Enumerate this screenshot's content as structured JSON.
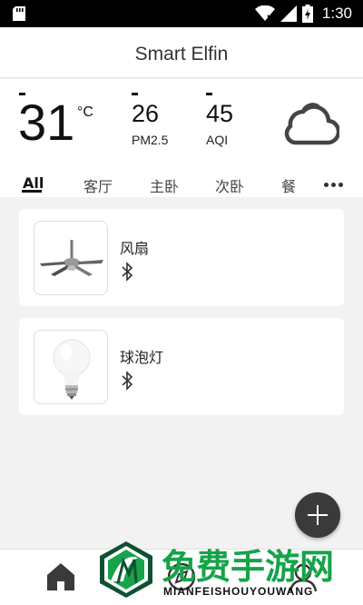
{
  "status_bar": {
    "time": "1:30",
    "icons": [
      "sd-card-icon",
      "wifi-icon",
      "signal-icon",
      "battery-charging-icon"
    ]
  },
  "header": {
    "title": "Smart Elfin"
  },
  "weather": {
    "temperature": "31",
    "unit": "°C",
    "pm25_value": "26",
    "pm25_label": "PM2.5",
    "aqi_value": "45",
    "aqi_label": "AQI",
    "condition_icon": "cloud-icon"
  },
  "tabs": {
    "items": [
      {
        "label": "All",
        "active": true
      },
      {
        "label": "客厅"
      },
      {
        "label": "主卧"
      },
      {
        "label": "次卧"
      },
      {
        "label": "餐厅"
      }
    ],
    "more_icon": "more-dots-icon"
  },
  "devices": [
    {
      "name": "风扇",
      "icon": "ceiling-fan-icon",
      "status_icon": "bluetooth-icon"
    },
    {
      "name": "球泡灯",
      "icon": "light-bulb-icon",
      "status_icon": "bluetooth-icon"
    }
  ],
  "fab": {
    "icon": "plus-icon"
  },
  "bottom_nav": [
    "home-icon",
    "discover-icon",
    "profile-icon"
  ],
  "watermark": {
    "title": "免费手游网",
    "subtitle": "MIANFEISHOUYOUWANG",
    "logo_letter": "M"
  },
  "colors": {
    "accent": "#16a34a",
    "fab": "#3a3a3a",
    "background": "#f2f2f2"
  }
}
